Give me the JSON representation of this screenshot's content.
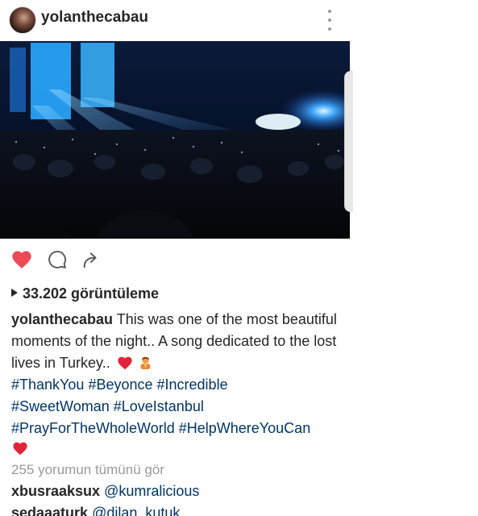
{
  "post": {
    "username": "yolanthecabau",
    "avatar_icon": "profile-avatar",
    "more_icon": "more-vertical-icon"
  },
  "actions": {
    "like_icon": "heart-filled-icon",
    "like_color": "#ed4956",
    "comment_icon": "comment-bubble-icon",
    "share_icon": "share-arrow-icon"
  },
  "stats": {
    "views": "33.202 görüntüleme"
  },
  "caption": {
    "username": "yolanthecabau",
    "text": "This was one of the most beautiful moments of the night.. A song dedicated to the lost lives in Turkey..",
    "emojis": [
      "red-heart-emoji",
      "person-praying-emoji"
    ]
  },
  "hashtags": [
    "#ThankYou",
    "#Beyonce",
    "#Incredible",
    "#SweetWoman",
    "#LoveIstanbul",
    "#PrayForTheWholeWorld",
    "#HelpWhereYouCan"
  ],
  "view_all_comments": "255 yorumun tümünü gör",
  "comments": [
    {
      "username": "xbusraaksux",
      "mention": "@kumralicious"
    },
    {
      "username": "sedaaaturk",
      "mention": "@dilan_kutuk"
    }
  ],
  "colors": {
    "hashtag": "#003569",
    "muted": "#999999",
    "text": "#262626"
  }
}
